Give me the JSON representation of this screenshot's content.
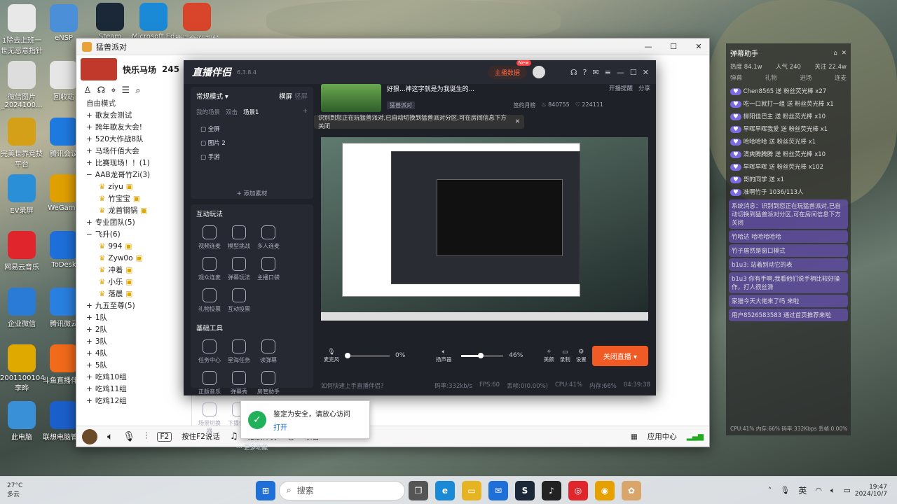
{
  "desktop": {
    "icons_left": [
      {
        "label": "1除去上班一世无恶意指针",
        "color": "#e8e8e8"
      },
      {
        "label": "微信图片_2024100...",
        "color": "#ddd"
      },
      {
        "label": "完美世界竞技平台",
        "color": "#d4a017"
      },
      {
        "label": "EV录屏",
        "color": "#2a8fd6"
      },
      {
        "label": "网易云音乐",
        "color": "#e0262c"
      },
      {
        "label": "企业微信",
        "color": "#2a7bd6"
      },
      {
        "label": "2001100104李晔",
        "color": "#e0a900"
      },
      {
        "label": "此电脑",
        "color": "#3a90d6"
      }
    ],
    "icons_col2": [
      {
        "label": "eNSP",
        "color": "#4a8fd8"
      },
      {
        "label": "回收站",
        "color": "#e6e6e6"
      },
      {
        "label": "腾讯会议",
        "color": "#1f7ae0"
      },
      {
        "label": "WeGame",
        "color": "#e0a000"
      },
      {
        "label": "ToDesk",
        "color": "#1e6fd9"
      },
      {
        "label": "腾讯微云",
        "color": "#2a80e0"
      },
      {
        "label": "斗鱼直播伴侣",
        "color": "#f26a1b"
      },
      {
        "label": "联想电脑管家",
        "color": "#1a5fcc"
      }
    ],
    "icons_top": [
      "Steam",
      "Microsoft Edge",
      "腾讯会议 视频会议"
    ]
  },
  "app": {
    "title": "猛兽派对",
    "channel_name": "快乐马场",
    "channel_id": "245",
    "mode_label": "自由模式",
    "groups": [
      {
        "name": "歌友会测试",
        "members": []
      },
      {
        "name": "跨年歌友大会!",
        "members": []
      },
      {
        "name": "520大作战8队",
        "members": []
      },
      {
        "name": "马场仟佰大会",
        "members": []
      },
      {
        "name": "比赛现场！！(1)",
        "members": []
      },
      {
        "name": "AAB龙哥竹Zi(3)",
        "members": [
          "ziyu",
          "竹宝宝",
          "龙首钢锅"
        ]
      },
      {
        "name": "专业团队(5)",
        "members": []
      },
      {
        "name": "飞升(6)",
        "members": [
          "994",
          "Zyw0o",
          "冲着",
          "小乐",
          "落晨"
        ]
      },
      {
        "name": "九五至尊(5)",
        "members": []
      },
      {
        "name": "1队",
        "members": []
      },
      {
        "name": "2队",
        "members": []
      },
      {
        "name": "3队",
        "members": []
      },
      {
        "name": "4队",
        "members": []
      },
      {
        "name": "5队",
        "members": []
      },
      {
        "name": "吃鸡10组",
        "members": []
      },
      {
        "name": "吃鸡11组",
        "members": []
      },
      {
        "name": "吃鸡12组",
        "members": []
      }
    ],
    "bottom_bar": {
      "ptt_key": "F2",
      "ptt_label": "按住F2说话",
      "music_label": "播放伴奏",
      "record_label": "录音",
      "app_center": "应用中心"
    }
  },
  "live": {
    "logo": "直播伴侣",
    "version": "6.3.8.4",
    "start_label": "主播数据",
    "new_badge": "New",
    "mode": "常规模式",
    "orientation": [
      "横屏",
      "竖屏"
    ],
    "scene_tabs": [
      "我的场景",
      "双击",
      "场景1"
    ],
    "sources": [
      "全屏",
      "图片 2",
      "手游"
    ],
    "add_source": "+ 添加素材",
    "stream_title": "好狠...神这字就是为我诞生的...",
    "game_tag": "猛兽派对",
    "open_note": "开播提醒",
    "share": "分享",
    "signups": "签约月榜",
    "likes": "840755",
    "hearts": "224111",
    "banner": "识别到您正在玩猛兽派对,已自动切换到猛兽派对分区,可在房间信息下方关闭",
    "interactive_title": "互动玩法",
    "interactive_tools": [
      "视频连麦",
      "模型挑战",
      "多人连麦",
      "观众连麦",
      "弹幕玩法",
      "主播口袋",
      "礼物投票",
      "互动投票"
    ],
    "basic_title": "基础工具",
    "basic_tools": [
      "任务中心",
      "星海任务",
      "读弹幕",
      "正版音乐",
      "弹幕秀",
      "房管助手",
      "场景切换器",
      "下播伴奏"
    ],
    "more": "更多功能",
    "mic_label": "麦克风",
    "mic_level": "0%",
    "speaker_label": "扬声器",
    "speaker_level": "46%",
    "mic_fraction": 0.0,
    "speaker_fraction": 0.46,
    "beauty": "美颜",
    "record": "录制",
    "settings": "设置",
    "stop_label": "关闭直播",
    "help": "如何快速上手直播伴侣?",
    "stats": [
      "码率:332kb/s",
      "FPS:60",
      "丢帧:0(0.00%)",
      "CPU:41%",
      "内存:66%",
      "04:39:38"
    ]
  },
  "chat": {
    "title": "弹幕助手",
    "stats": [
      "热度 84.1w",
      "人气 240",
      "关注 22.4w"
    ],
    "tabs": [
      "弹幕",
      "礼物",
      "进场",
      "连麦"
    ],
    "lines": [
      "Chen8565 送 粉丝荧光棒 x27",
      "吃一口就打一组 送 粉丝荧光棒 x1",
      "柳阳佳巴主 送 粉丝荧光棒 x10",
      "早晖早晖我爱 送 粉丝荧光棒 x1",
      "哈哈哈哈 送 粉丝荧光棒 x1",
      "清爽腾腾腾 送 粉丝荧光棒 x10",
      "早晖早晖 送 粉丝荧光棒 x102",
      "哥的同学 送 x1",
      "准啊竹子 1036/113人"
    ],
    "highlight_lines": [
      "系统消息：识别到您正在玩猛兽派对,已自动切换到猛兽派对分区,可在房间信息下方关闭",
      "竹哈达 哈哈哈哈哈",
      "竹子居然是窗口模式",
      "b1u3: 站着别动它的表",
      "b1u3 你有手啊,我看他们说手柄比较好操作，打人很丝滑",
      "家猫今天大佬来了吗 来啦",
      "用户8526583583 通过首页推荐来啦"
    ],
    "footer": "CPU:41% 内存:66% 码率:332Kbps 丢帧:0.00%"
  },
  "toast": {
    "title": "鉴定为安全，请放心访问",
    "link": "打开"
  },
  "taskbar": {
    "weather_temp": "27°C",
    "weather_desc": "多云",
    "search": "搜索",
    "lang": "英",
    "time": "19:47",
    "date": "2024/10/7"
  }
}
